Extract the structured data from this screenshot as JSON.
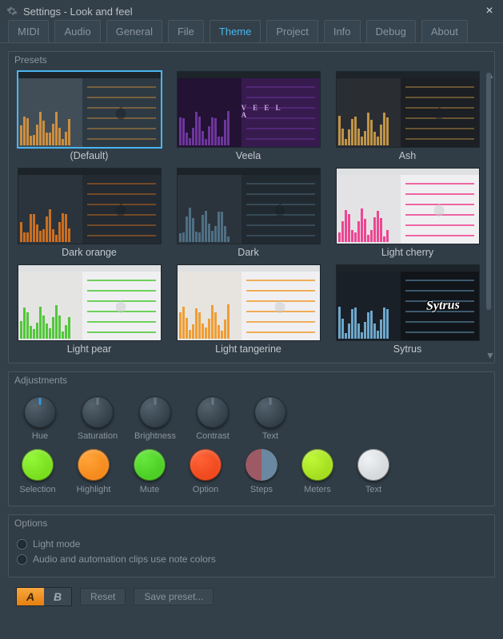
{
  "window": {
    "title": "Settings - Look and feel"
  },
  "tabs": {
    "items": [
      "MIDI",
      "Audio",
      "General",
      "File",
      "Theme",
      "Project",
      "Info",
      "Debug",
      "About"
    ],
    "active": 4
  },
  "presets": {
    "title": "Presets",
    "selected": 0,
    "items": [
      {
        "label": "(Default)",
        "bg": "#2e3a43",
        "accent": "#e69a3a",
        "mixer": "#414e58"
      },
      {
        "label": "Veela",
        "bg": "#371b4f",
        "accent": "#7a3db0",
        "mixer": "#231233",
        "overlay": "veela"
      },
      {
        "label": "Ash",
        "bg": "#1c1f23",
        "accent": "#dba64c",
        "mixer": "#2a2e33"
      },
      {
        "label": "Dark orange",
        "bg": "#232a31",
        "accent": "#e87a1c",
        "mixer": "#2b343c"
      },
      {
        "label": "Dark",
        "bg": "#222a31",
        "accent": "#567a8f",
        "mixer": "#2b343c"
      },
      {
        "label": "Light cherry",
        "bg": "#f5f5f7",
        "accent": "#ee2a82",
        "mixer": "#e3e3e6",
        "light": true
      },
      {
        "label": "Light pear",
        "bg": "#f5f6f4",
        "accent": "#38c21d",
        "mixer": "#e4e5e3",
        "light": true
      },
      {
        "label": "Light tangerine",
        "bg": "#f7f5f1",
        "accent": "#f09016",
        "mixer": "#e7e4df",
        "light": true
      },
      {
        "label": "Sytrus",
        "bg": "#11151a",
        "accent": "#7ec0e8",
        "mixer": "#1a2027",
        "overlay": "sytrus"
      }
    ]
  },
  "adjustments": {
    "title": "Adjustments",
    "knobs": [
      "Hue",
      "Saturation",
      "Brightness",
      "Contrast",
      "Text"
    ],
    "swatches": [
      {
        "label": "Selection",
        "color": "#7adf1e"
      },
      {
        "label": "Highlight",
        "color": "#f58b1e"
      },
      {
        "label": "Mute",
        "color": "#4ecf25"
      },
      {
        "label": "Option",
        "color": "#f04a1e"
      },
      {
        "label": "Steps",
        "split": [
          "#9d5a65",
          "#6a88a0"
        ]
      },
      {
        "label": "Meters",
        "color": "#a6df20"
      },
      {
        "label": "Text",
        "color": "#d7dadd"
      }
    ]
  },
  "options": {
    "title": "Options",
    "items": [
      {
        "label": "Light mode",
        "checked": false
      },
      {
        "label": "Audio and automation clips use note colors",
        "checked": false
      }
    ]
  },
  "footer": {
    "ab": {
      "a": "A",
      "b": "B",
      "active": "a"
    },
    "reset": "Reset",
    "save": "Save preset..."
  }
}
